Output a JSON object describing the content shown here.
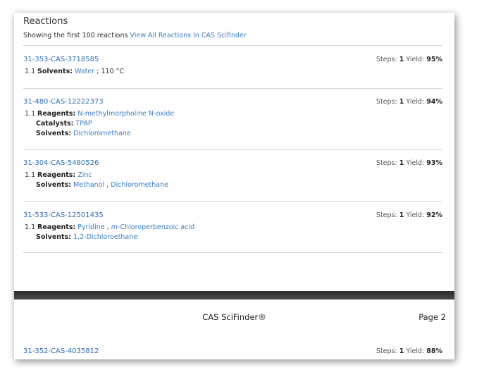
{
  "section": {
    "title": "Reactions",
    "showing_text": "Showing the first 100 reactions",
    "view_all_link": "View All Reactions In CAS Scifinder"
  },
  "reactions": [
    {
      "id": "31-353-CAS-3718585",
      "steps_label": "Steps:",
      "steps": "1",
      "yield_label": "Yield:",
      "yield": "95%",
      "step": "1.1",
      "solvents_label": "Solvents:",
      "solvents": "Water",
      "temperature": "; 110 °C"
    },
    {
      "id": "31-480-CAS-12222373",
      "steps_label": "Steps:",
      "steps": "1",
      "yield_label": "Yield:",
      "yield": "94%",
      "step": "1.1",
      "reagents_label": "Reagents:",
      "reagents": "N-methylmorpholine N-oxide",
      "catalysts_label": "Catalysts:",
      "catalysts": "TPAP",
      "solvents_label": "Solvents:",
      "solvents": "Dichloromethane"
    },
    {
      "id": "31-304-CAS-5480526",
      "steps_label": "Steps:",
      "steps": "1",
      "yield_label": "Yield:",
      "yield": "93%",
      "step": "1.1",
      "reagents_label": "Reagents:",
      "reagents": "Zinc",
      "solvents_label": "Solvents:",
      "solvent_a": "Methanol",
      "separator": ",",
      "solvent_b": "Dichloromethane"
    },
    {
      "id": "31-533-CAS-12501435",
      "steps_label": "Steps:",
      "steps": "1",
      "yield_label": "Yield:",
      "yield": "92%",
      "step": "1.1",
      "reagents_label": "Reagents:",
      "reagent_a": "Pyridine",
      "separator": ",",
      "reagent_b_prefix": "m",
      "reagent_b_rest": "-Chloroperbenzoic acid",
      "solvents_label": "Solvents:",
      "solvents": "1,2-Dichloroethane"
    },
    {
      "id": "31-352-CAS-4035812",
      "steps_label": "Steps:",
      "steps": "1",
      "yield_label": "Yield:",
      "yield": "88%"
    }
  ],
  "footer": {
    "title": "CAS SciFinder®",
    "page": "Page 2"
  }
}
